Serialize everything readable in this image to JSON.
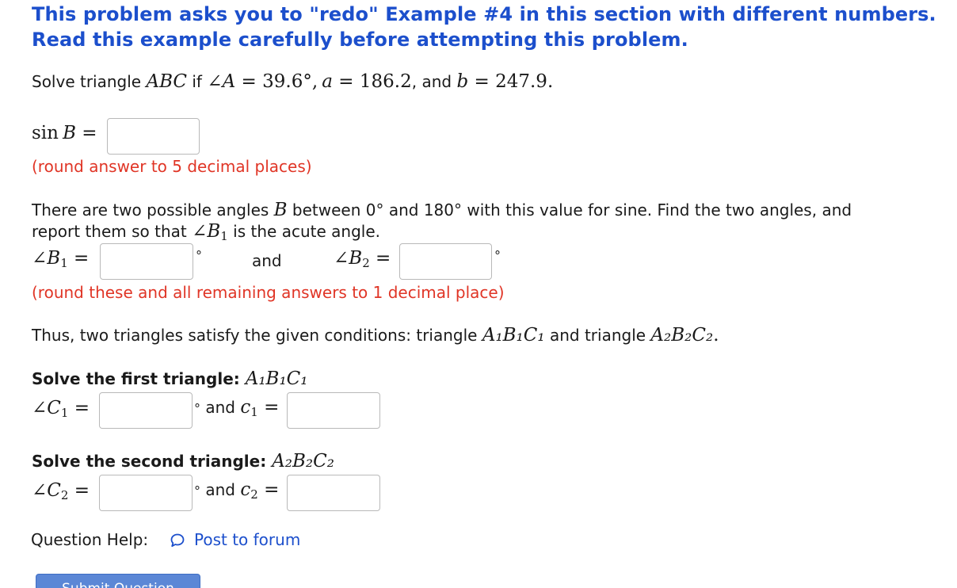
{
  "heading": {
    "line1": "This problem asks you to \"redo\" Example #4 in this section with different numbers.",
    "line2": "Read this example carefully before attempting this problem."
  },
  "problem": {
    "prefix": "Solve triangle ",
    "triangle": "ABC",
    "if": " if ",
    "angle_sym": "∠",
    "angle_A": "A",
    "eq": " = ",
    "angle_A_value": "39.6°",
    "comma": ",",
    "a_var": "a",
    "a_value": "186.2",
    "and": ", and ",
    "b_var": "b",
    "b_value": "247.9",
    "period": "."
  },
  "sinB": {
    "label_sin": "sin",
    "label_var": "B",
    "eq": " =",
    "value": "",
    "hint": "(round answer to 5 decimal places)"
  },
  "angles_text": {
    "line1_a": "There are two possible angles ",
    "line1_var": "B",
    "line1_b": " between 0° and 180° with this value for sine. Find the two angles, and",
    "line2_a": "report them so that ",
    "line2_angle": "∠",
    "line2_var": "B",
    "line2_sub": "1",
    "line2_b": " is the acute angle."
  },
  "B_fields": {
    "b1_label_angle": "∠",
    "b1_label_var": "B",
    "b1_label_sub": "1",
    "eq": " =",
    "b1_value": "",
    "deg": "°",
    "and": "and",
    "b2_label_angle": "∠",
    "b2_label_var": "B",
    "b2_label_sub": "2",
    "b2_value": "",
    "hint": "(round these and all remaining answers to 1 decimal place)"
  },
  "thus": {
    "text_a": "Thus, two triangles satisfy the given conditions: triangle ",
    "t1": "A₁B₁C₁",
    "text_b": " and triangle ",
    "t2": "A₂B₂C₂",
    "text_c": "."
  },
  "first_triangle": {
    "title": "Solve the first triangle: ",
    "title_math": "A₁B₁C₁",
    "angle_label_angle": "∠",
    "angle_label_var": "C",
    "angle_label_sub": "1",
    "eq": " =",
    "angle_value": "",
    "deg": "°",
    "and": " and ",
    "side_var": "c",
    "side_sub": "1",
    "side_value": ""
  },
  "second_triangle": {
    "title": "Solve the second triangle: ",
    "title_math": "A₂B₂C₂",
    "angle_label_angle": "∠",
    "angle_label_var": "C",
    "angle_label_sub": "2",
    "eq": " =",
    "angle_value": "",
    "deg": "°",
    "and": " and ",
    "side_var": "c",
    "side_sub": "2",
    "side_value": ""
  },
  "help": {
    "label": "Question Help:",
    "icon": "speech-bubble-icon",
    "link": "Post to forum"
  },
  "submit": {
    "label": "Submit Question"
  },
  "colors": {
    "heading": "#1c4fcc",
    "hint": "#e03526",
    "link": "#1c4fcc",
    "submit_bg": "#5b87d6"
  }
}
